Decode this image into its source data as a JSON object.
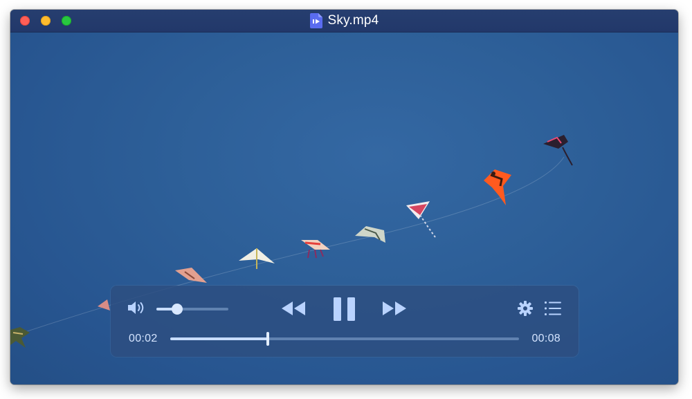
{
  "window": {
    "title": "Sky.mp4",
    "file_icon": "video-file-icon"
  },
  "traffic_lights": {
    "close": "#fe5f57",
    "minimize": "#febc2e",
    "maximize": "#28c840"
  },
  "player": {
    "current_time": "00:02",
    "duration": "00:08",
    "progress_fraction": 0.28,
    "volume_fraction": 0.29,
    "state": "playing",
    "controls": {
      "volume": "speaker-icon",
      "rewind": "rewind-icon",
      "pause": "pause-icon",
      "fast_forward": "fast-forward-icon",
      "settings": "gear-icon",
      "playlist": "list-icon"
    }
  },
  "colors": {
    "titlebar": "#22386a",
    "sky": "#2d5f98",
    "hud": "#2d4e80",
    "control_icon": "#b9d3ff"
  }
}
